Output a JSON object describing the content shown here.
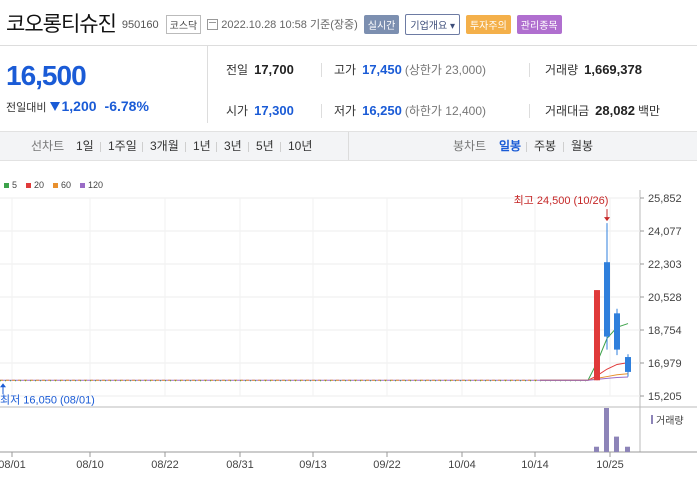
{
  "header": {
    "name": "코오롱티슈진",
    "code": "950160",
    "market": "코스닥",
    "datetime": "2022.10.28 10:58",
    "basis": "기준(장중)",
    "badges": {
      "realtime": "실시간",
      "info": "기업개요 ▾",
      "warning": "투자주의",
      "admin": "관리종목"
    }
  },
  "price": {
    "current": "16,500",
    "change_label": "전일대비",
    "change": "1,200",
    "change_pct": "-6.78%"
  },
  "stats": {
    "prev": {
      "label": "전일",
      "value": "17,700"
    },
    "high": {
      "label": "고가",
      "value": "17,450",
      "sub": "(상한가 23,000)"
    },
    "volume": {
      "label": "거래량",
      "value": "1,669,378"
    },
    "open": {
      "label": "시가",
      "value": "17,300"
    },
    "low": {
      "label": "저가",
      "value": "16,250",
      "sub": "(하한가 12,400)"
    },
    "amount": {
      "label": "거래대금",
      "value": "28,082",
      "unit": "백만"
    }
  },
  "periods": {
    "line_label": "선차트",
    "line_options": [
      "1일",
      "1주일",
      "3개월",
      "1년",
      "3년",
      "5년",
      "10년"
    ],
    "candle_label": "봉차트",
    "candle_options": [
      "일봉",
      "주봉",
      "월봉"
    ],
    "candle_selected": "일봉"
  },
  "chart_data": {
    "type": "line",
    "legend": [
      {
        "name": "5",
        "color": "#3ca24a"
      },
      {
        "name": "20",
        "color": "#e03a3a"
      },
      {
        "name": "60",
        "color": "#e8902e"
      },
      {
        "name": "120",
        "color": "#9a6cc6"
      }
    ],
    "y_ticks": [
      "25,852",
      "24,077",
      "22,303",
      "20,528",
      "18,754",
      "16,979",
      "15,205"
    ],
    "ylim": [
      15205,
      25852
    ],
    "x_ticks": [
      "08/01",
      "08/10",
      "08/22",
      "08/31",
      "09/13",
      "09/22",
      "10/04",
      "10/14",
      "10/25"
    ],
    "max_label": "최고 24,500 (10/26)",
    "min_label": "최저 16,050 (08/01)",
    "volume_label": "거래량",
    "flat_price": 16050,
    "candles": [
      {
        "open": 16050,
        "close": 20900,
        "high": 20900,
        "low": 16050,
        "color": "#e03a3a"
      },
      {
        "open": 22400,
        "close": 18400,
        "high": 24500,
        "low": 17700,
        "color": "#2f7fdc"
      },
      {
        "open": 19650,
        "close": 17700,
        "high": 19900,
        "low": 17400,
        "color": "#2f7fdc"
      },
      {
        "open": 17300,
        "close": 16500,
        "high": 17450,
        "low": 16250,
        "color": "#2f7fdc"
      }
    ],
    "series": [
      {
        "name": "5",
        "values": [
          16050,
          16050,
          17000,
          18300,
          18900,
          19100
        ]
      },
      {
        "name": "20",
        "values": [
          16050,
          16050,
          16300,
          16650,
          16900,
          17000
        ]
      },
      {
        "name": "60",
        "values": [
          16050,
          16050,
          16150,
          16250,
          16350,
          16400
        ]
      },
      {
        "name": "120",
        "values": [
          16050,
          16050,
          16100,
          16150,
          16200,
          16230
        ]
      }
    ],
    "volume_bars": [
      0.12,
      1.0,
      0.35,
      0.12
    ]
  }
}
